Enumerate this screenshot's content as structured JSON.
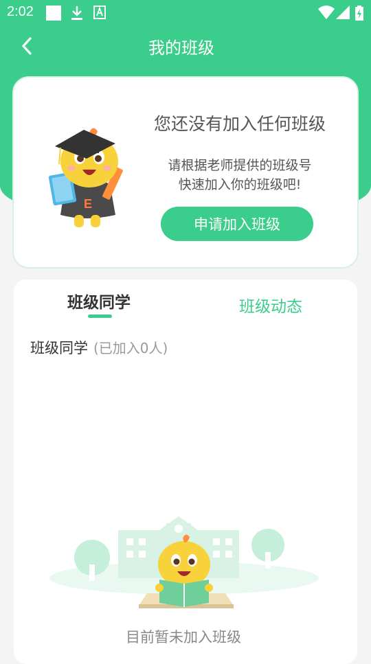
{
  "status_bar": {
    "time": "2:02",
    "icons": [
      "notification-square-icon",
      "download-icon",
      "font-a-icon",
      "wifi-icon",
      "signal-icon",
      "battery-charging-icon"
    ]
  },
  "header": {
    "title": "我的班级",
    "back_icon": "chevron-left-icon"
  },
  "join_card": {
    "heading": "您还没有加入任何班级",
    "desc_line1": "请根据老师提供的班级号",
    "desc_line2": "快速加入你的班级吧!",
    "button_label": "申请加入班级",
    "mascot": "graduate-dragon-mascot"
  },
  "tabs": [
    {
      "label": "班级同学",
      "active": true
    },
    {
      "label": "班级动态",
      "active": false
    }
  ],
  "classmates": {
    "label": "班级同学",
    "count_text": "(已加入0人)"
  },
  "empty_state": {
    "text": "目前暂未加入班级",
    "illustration": "reading-dragon-school-illustration"
  },
  "colors": {
    "accent": "#3bcd8c",
    "background": "#f4f4f4",
    "card_border": "#d6f1e4"
  }
}
